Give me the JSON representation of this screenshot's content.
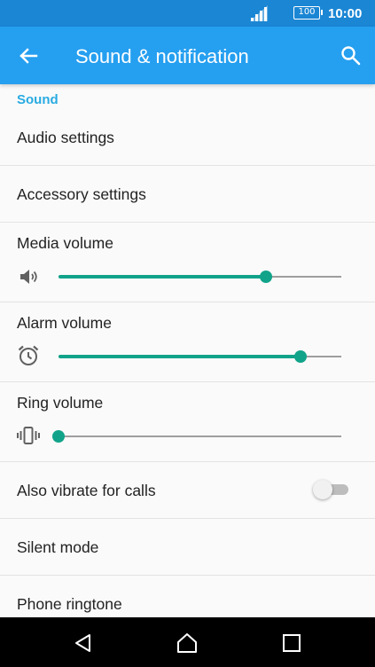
{
  "status_bar": {
    "battery": "100",
    "time": "10:00"
  },
  "app_bar": {
    "title": "Sound & notification",
    "back_icon": "arrow-left-icon",
    "search_icon": "search-icon"
  },
  "section": {
    "header": "Sound"
  },
  "items": {
    "audio_settings": "Audio settings",
    "accessory_settings": "Accessory settings",
    "media_volume": {
      "label": "Media volume",
      "icon": "speaker-icon",
      "level_percent": 73.5
    },
    "alarm_volume": {
      "label": "Alarm volume",
      "icon": "alarm-clock-icon",
      "level_percent": 85.5
    },
    "ring_volume": {
      "label": "Ring volume",
      "icon": "vibrate-icon",
      "level_percent": 0
    },
    "also_vibrate": {
      "label": "Also vibrate for calls",
      "enabled": false
    },
    "silent_mode": "Silent mode",
    "phone_ringtone": "Phone ringtone"
  },
  "colors": {
    "status_bar": "#1b86d4",
    "app_bar": "#259ff0",
    "section_header": "#29abe2",
    "accent": "#11a38a"
  },
  "nav_bar": {
    "back_icon": "nav-back-icon",
    "home_icon": "nav-home-icon",
    "recents_icon": "nav-recents-icon"
  }
}
